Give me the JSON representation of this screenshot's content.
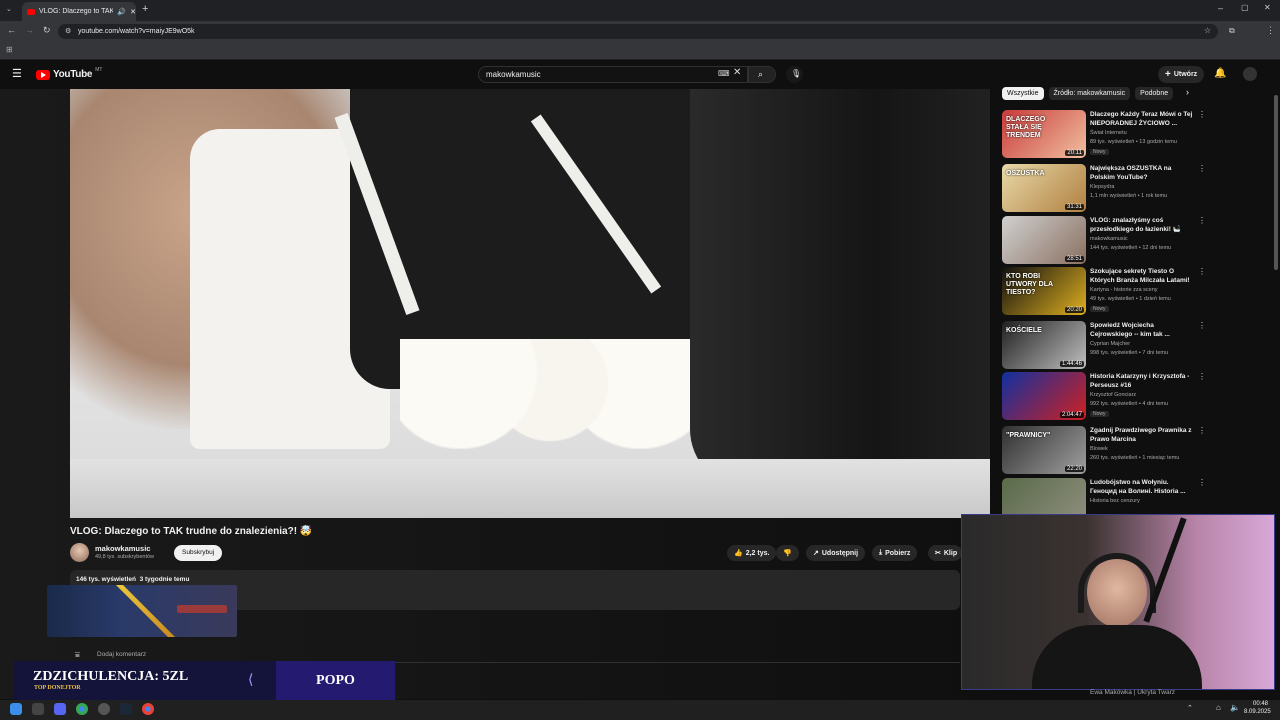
{
  "browser": {
    "tab_title": "VLOG: Dlaczego to TAK trudn",
    "new_tab_label": "+",
    "url": "youtube.com/watch?v=maiyJE9wO5k"
  },
  "masthead": {
    "logo": "YouTube",
    "region": "MT",
    "search_value": "makowkamusic",
    "create_label": "Utwórz"
  },
  "filters": [
    "Wszystkie",
    "Źródło: makowkamusic",
    "Podobne"
  ],
  "video": {
    "title": "VLOG: Dlaczego to TAK trudne do znalezienia?! 🤯",
    "channel": "makowkamusic",
    "subscribers": "49,8 tys. subskrybentów",
    "subscribe_label": "Subskrybuj",
    "likes": "2,2 tys.",
    "share_label": "Udostępnij",
    "download_label": "Pobierz",
    "clip_label": "Klip",
    "meta": "146 tys. wyświetleń  3 tygodnie temu",
    "add_comment": "Dodaj komentarz"
  },
  "recommendations": [
    {
      "title": "Dlaczego Każdy Teraz Mówi o Tej NIEPORADNEJ ŻYCIOWO ...",
      "channel": "Świat Internetu",
      "meta": "89 tys. wyświetleń • 13 godzin temu",
      "duration": "20:11",
      "badge": "Nowy",
      "thumb_text": "DLACZEGO STAŁA SIĘ TRENDEM",
      "colors": [
        "#c93a3a",
        "#f0c0a0"
      ]
    },
    {
      "title": "Największa OSZUSTKA na Polskim YouTube?",
      "channel": "Klepsydra",
      "meta": "1,1 mln wyświetleń • 1 rok temu",
      "duration": "31:31",
      "badge": "",
      "thumb_text": "OSZUSTKA",
      "colors": [
        "#e8d8a8",
        "#b08040"
      ]
    },
    {
      "title": "VLOG: znalazłyśmy coś przesłodkiego do łazienki! 🛀",
      "channel": "makowkamusic",
      "meta": "144 tys. wyświetleń • 12 dni temu",
      "duration": "28:51",
      "badge": "",
      "thumb_text": "",
      "colors": [
        "#d0d0d0",
        "#8a7060"
      ]
    },
    {
      "title": "Szokujące sekrety Tiesto O Których Branża Milczała Latami!",
      "channel": "Kartyna - historie zza sceny",
      "meta": "49 tys. wyświetleń • 1 dzień temu",
      "duration": "20:20",
      "badge": "Nowy",
      "thumb_text": "KTO ROBI UTWORY DLA TIESTO?",
      "colors": [
        "#101010",
        "#e0b020"
      ]
    },
    {
      "title": "Spowiedź Wojciecha Cejrowskiego -- kim tak ...",
      "channel": "Cyprian Majcher",
      "meta": "998 tys. wyświetleń • 7 dni temu",
      "duration": "1:44:46",
      "badge": "",
      "thumb_text": "KOŚCIELE",
      "colors": [
        "#202020",
        "#c0c0c0"
      ]
    },
    {
      "title": "Historia Katarzyny i Krzysztofa - Perseusz #16",
      "channel": "Krzysztof Gonciarz",
      "meta": "992 tys. wyświetleń • 4 dni temu",
      "duration": "2:04:47",
      "badge": "Nowy",
      "thumb_text": "",
      "colors": [
        "#1030a0",
        "#d02020"
      ]
    },
    {
      "title": "Zgadnij Prawdziwego Prawnika z Prawo Marcina",
      "channel": "Blowek",
      "meta": "260 tys. wyświetleń • 1 miesiąc temu",
      "duration": "22:20",
      "badge": "",
      "thumb_text": "\"PRAWNICY\"",
      "colors": [
        "#303030",
        "#a0a0a0"
      ]
    },
    {
      "title": "Ludobójstwo na Wołyniu. Геноцид на Волині. Historia ...",
      "channel": "Historia bez cenzury",
      "meta": "",
      "duration": "",
      "badge": "",
      "thumb_text": "",
      "colors": [
        "#5a6a4a",
        "#909080"
      ]
    }
  ],
  "overlay": {
    "donation_text": "ZDZICHULENCJA: 5ZL",
    "donation_sub": "TOP DONEJTOR",
    "popo": "POPO",
    "bottom_label": "Ewa Makówka | Ukryta Twarz"
  },
  "taskbar": {
    "time": "00:48",
    "date": "8.09.2025"
  }
}
